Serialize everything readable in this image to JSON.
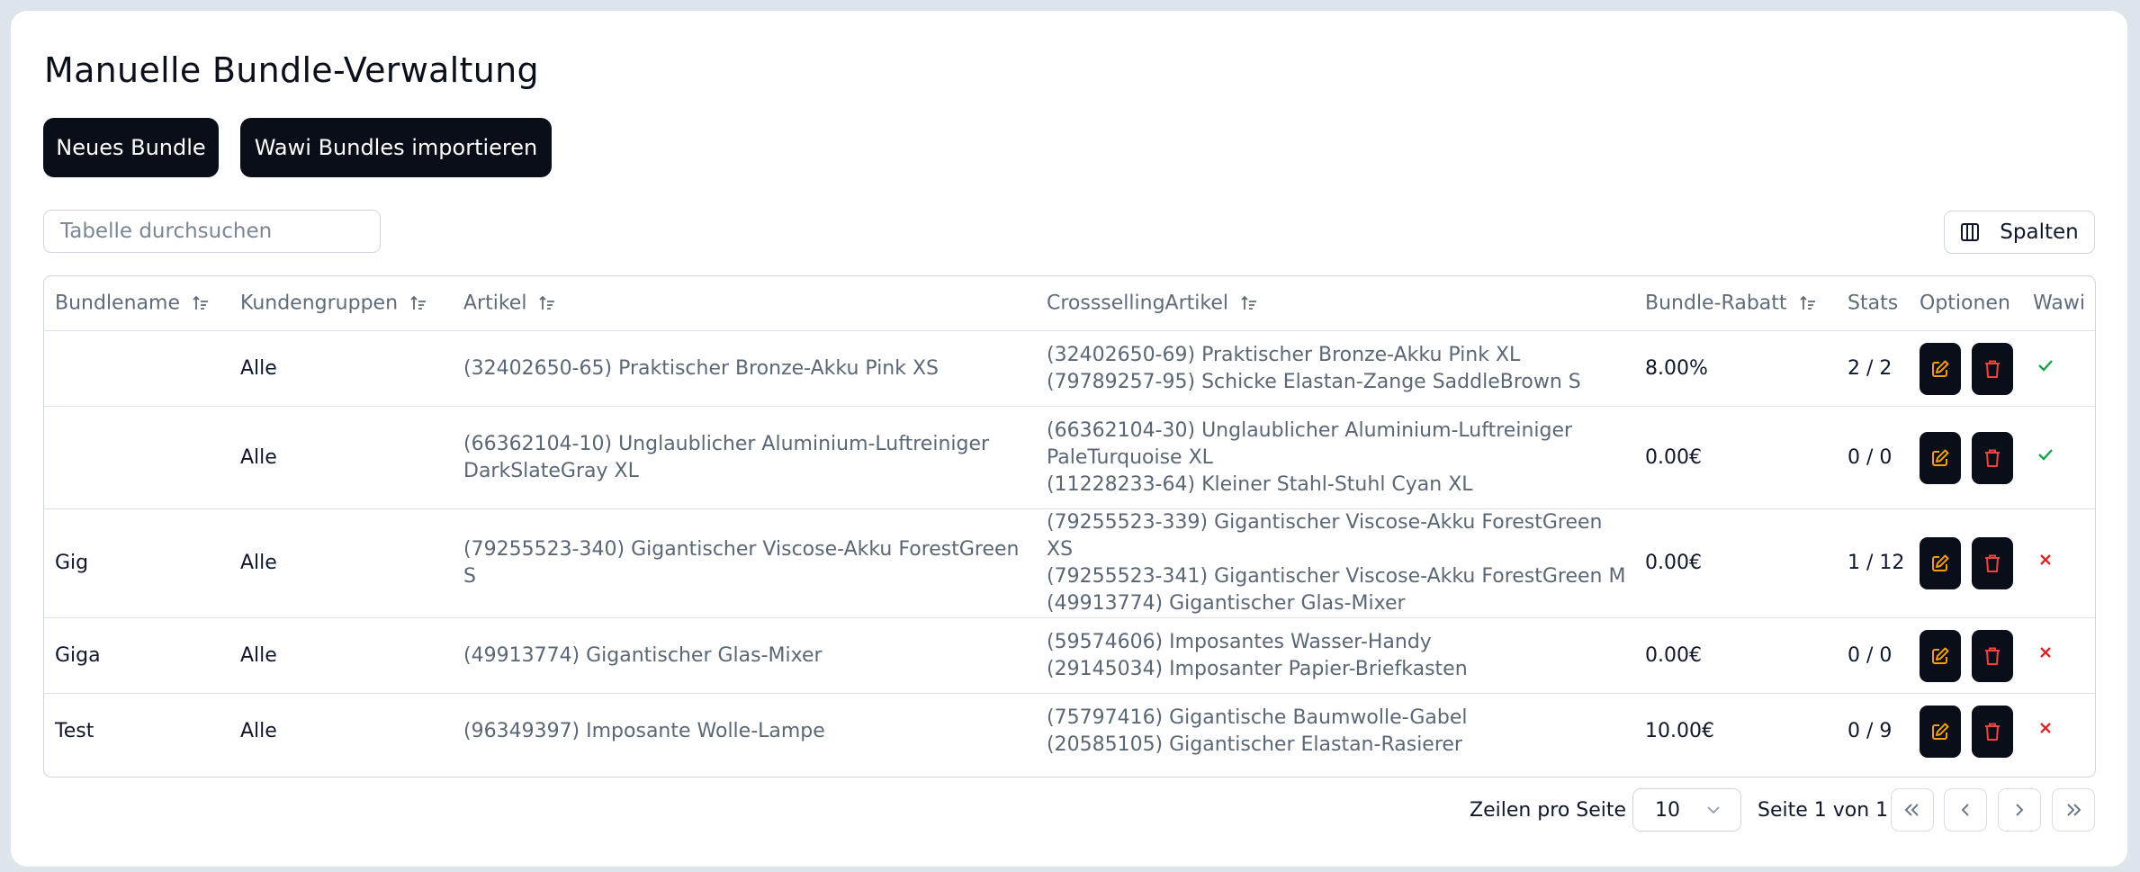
{
  "page": {
    "title": "Manuelle Bundle-Verwaltung"
  },
  "actions": {
    "new_bundle": "Neues Bundle",
    "import_wawi": "Wawi Bundles importieren"
  },
  "search": {
    "placeholder": "Tabelle durchsuchen",
    "value": ""
  },
  "columns_button": {
    "label": "Spalten",
    "icon": "columns-icon"
  },
  "table": {
    "headers": [
      "Bundlename",
      "Kundengruppen",
      "Artikel",
      "CrosssellingArtikel",
      "Bundle-Rabatt",
      "Stats",
      "Optionen",
      "Wawi"
    ],
    "rows": [
      {
        "bundlename": "",
        "kundengruppen": "Alle",
        "artikel": [
          "(32402650-65) Praktischer Bronze-Akku Pink XS"
        ],
        "crossselling": [
          "(32402650-69) Praktischer Bronze-Akku Pink XL",
          "(79789257-95) Schicke Elastan-Zange SaddleBrown S"
        ],
        "rabatt": "8.00%",
        "stats": "2 / 2",
        "wawi": true
      },
      {
        "bundlename": "",
        "kundengruppen": "Alle",
        "artikel": [
          "(66362104-10) Unglaublicher Aluminium-Luftreiniger",
          "DarkSlateGray XL"
        ],
        "crossselling": [
          "(66362104-30) Unglaublicher Aluminium-Luftreiniger",
          "PaleTurquoise XL",
          "(11228233-64) Kleiner Stahl-Stuhl Cyan XL"
        ],
        "rabatt": "0.00€",
        "stats": "0 / 0",
        "wawi": true
      },
      {
        "bundlename": "Gig",
        "kundengruppen": "Alle",
        "artikel": [
          "(79255523-340) Gigantischer Viscose-Akku ForestGreen S"
        ],
        "crossselling": [
          "(79255523-339) Gigantischer Viscose-Akku ForestGreen XS",
          "(79255523-341) Gigantischer Viscose-Akku ForestGreen M",
          "(49913774) Gigantischer Glas-Mixer"
        ],
        "rabatt": "0.00€",
        "stats": "1 / 12",
        "wawi": false
      },
      {
        "bundlename": "Giga",
        "kundengruppen": "Alle",
        "artikel": [
          "(49913774) Gigantischer Glas-Mixer"
        ],
        "crossselling": [
          "(59574606) Imposantes Wasser-Handy",
          "(29145034) Imposanter Papier-Briefkasten"
        ],
        "rabatt": "0.00€",
        "stats": "0 / 0",
        "wawi": false
      },
      {
        "bundlename": "Test",
        "kundengruppen": "Alle",
        "artikel": [
          "(96349397) Imposante Wolle-Lampe"
        ],
        "crossselling": [
          "(75797416) Gigantische Baumwolle-Gabel",
          "(20585105) Gigantischer Elastan-Rasierer"
        ],
        "rabatt": "10.00€",
        "stats": "0 / 9",
        "wawi": false
      }
    ]
  },
  "pagination": {
    "rows_per_page_label": "Zeilen pro Seite",
    "rows_per_page_value": "10",
    "page_info": "Seite 1 von 1"
  },
  "colors": {
    "primary": "#0a0e18",
    "edit_icon": "#f59e0b",
    "delete_icon": "#ef4444",
    "check": "#16a34a",
    "cross": "#dc2626"
  }
}
